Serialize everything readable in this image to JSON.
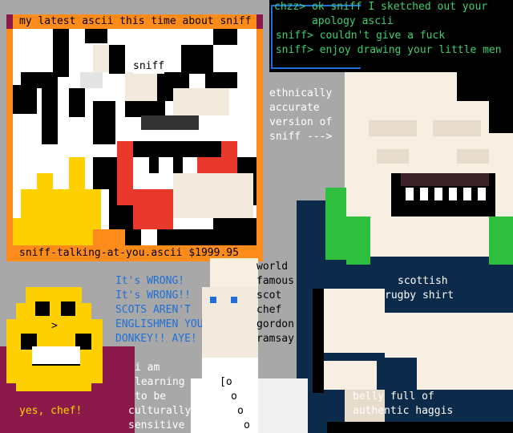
{
  "colors": {
    "background": "#a8a8a8",
    "frame_orange": "#ff8c1a",
    "frame_maroon": "#8b1a4a",
    "terminal_bg": "#000000",
    "terminal_green": "#3cd070",
    "blue_text": "#1f6fd6",
    "yellow_text": "#ffd400",
    "navy": "#0c2a4a",
    "green_shirt": "#2fbf3f",
    "cream": "#f6efe2",
    "red": "#e8382c",
    "gold": "#ffd000"
  },
  "art_panel": {
    "title": "my latest ascii this time about sniff",
    "art_label": "sniff",
    "caption": "sniff-talking-at-you.ascii $1999.95"
  },
  "terminal": {
    "lines": [
      "chzz> ok sniff I sketched out your",
      "      apology ascii",
      " sniff> couldn't give a fuck",
      " sniff> enjoy drawing your little men"
    ]
  },
  "side_caption": {
    "lines": [
      "ethnically",
      "accurate",
      "version of",
      "sniff --->"
    ]
  },
  "chef_panel": {
    "face_glyph": ">",
    "caption": "yes, chef!"
  },
  "rant": {
    "lines": [
      "It's WRONG!",
      "It's WRONG!!",
      "SCOTS AREN'T",
      "ENGLISHMEN YOU",
      "DONKEY!! AYE! \\"
    ]
  },
  "ramsay_caption": {
    "lines": [
      "world",
      "famous",
      "scot",
      "chef",
      "gordon",
      "ramsay"
    ]
  },
  "learning": {
    "lines": [
      "i am",
      "learning",
      "to be",
      "culturally",
      "sensitive"
    ]
  },
  "chef_coat": {
    "buttons": [
      "[o",
      "o",
      "o",
      "o"
    ]
  },
  "shirt_label": {
    "lines": [
      "scottish",
      "rugby shirt"
    ]
  },
  "belly_label": {
    "lines": [
      "belly full of",
      "authentic haggis"
    ]
  },
  "icons": [
    "sniff-ascii-portrait",
    "chef-smiley",
    "gordon-ramsay-ascii",
    "scottish-sniff-ascii"
  ]
}
